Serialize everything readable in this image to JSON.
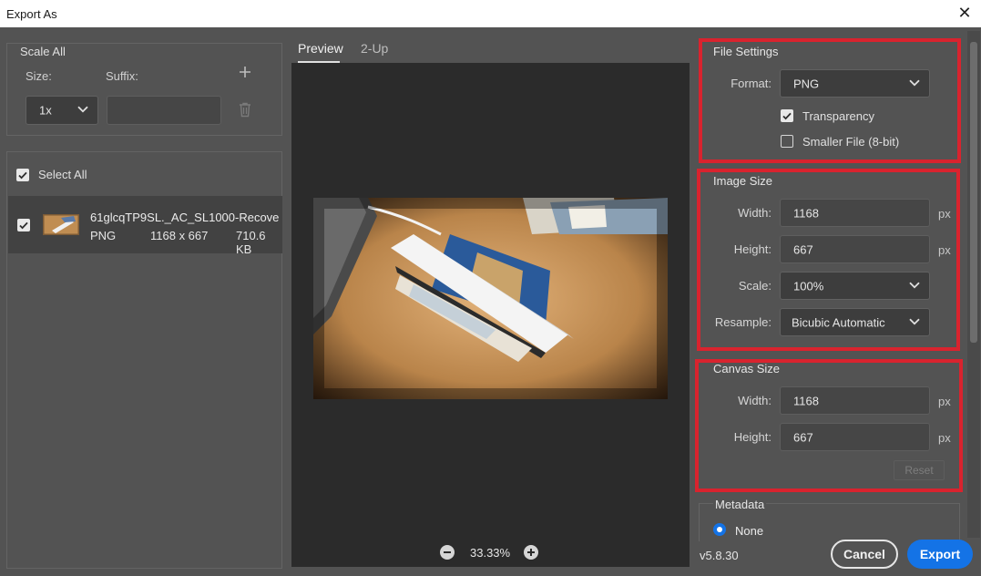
{
  "window": {
    "title": "Export As",
    "close_symbol": "✕"
  },
  "scale_all": {
    "title": "Scale All",
    "size_label": "Size:",
    "suffix_label": "Suffix:",
    "size_value": "1x",
    "suffix_value": ""
  },
  "files": {
    "select_all_label": "Select All",
    "select_all_checked": true,
    "items": [
      {
        "name": "61glcqTP9SL._AC_SL1000-Recove",
        "format": "PNG",
        "dimensions": "1168 x 667",
        "filesize": "710.6 KB",
        "checked": true
      }
    ]
  },
  "tabs": [
    {
      "label": "Preview",
      "active": true
    },
    {
      "label": "2-Up",
      "active": false
    }
  ],
  "zoom": {
    "level": "33.33%"
  },
  "file_settings": {
    "title": "File Settings",
    "format_label": "Format:",
    "format_value": "PNG",
    "transparency_label": "Transparency",
    "transparency_checked": true,
    "smaller_file_label": "Smaller File (8-bit)",
    "smaller_file_checked": false
  },
  "image_size": {
    "title": "Image Size",
    "width_label": "Width:",
    "width_value": "1168",
    "height_label": "Height:",
    "height_value": "667",
    "unit": "px",
    "scale_label": "Scale:",
    "scale_value": "100%",
    "resample_label": "Resample:",
    "resample_value": "Bicubic Automatic"
  },
  "canvas_size": {
    "title": "Canvas Size",
    "width_label": "Width:",
    "width_value": "1168",
    "height_label": "Height:",
    "height_value": "667",
    "unit": "px",
    "reset_label": "Reset"
  },
  "metadata": {
    "title": "Metadata",
    "none_label": "None",
    "none_selected": true
  },
  "footer": {
    "version": "v5.8.30",
    "cancel_label": "Cancel",
    "export_label": "Export"
  },
  "colors": {
    "accent": "#1473e6",
    "highlight": "#d9232e",
    "panel": "#535353",
    "preview_bg": "#2b2b2b"
  }
}
